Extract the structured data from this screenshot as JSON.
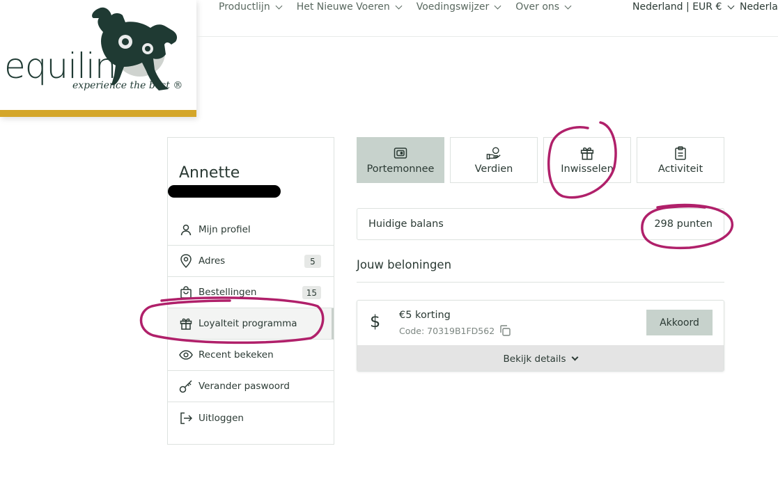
{
  "header": {
    "logo": {
      "text": "equilin",
      "tagline": "experience the best ®"
    },
    "nav": [
      {
        "label": "Productlijn"
      },
      {
        "label": "Het Nieuwe Voeren"
      },
      {
        "label": "Voedingswijzer"
      },
      {
        "label": "Over ons"
      }
    ],
    "region_label": "Nederland | EUR €",
    "language_label": "Nederlan"
  },
  "sidebar": {
    "user_name": "Annette",
    "items": [
      {
        "label": "Mijn profiel",
        "icon": "user-icon"
      },
      {
        "label": "Adres",
        "icon": "location-pin-icon",
        "badge": "5"
      },
      {
        "label": "Bestellingen",
        "icon": "shopping-bag-icon",
        "badge": "15"
      },
      {
        "label": "Loyalteit programma",
        "icon": "gift-icon",
        "active": true
      },
      {
        "label": "Recent bekeken",
        "icon": "eye-icon"
      },
      {
        "label": "Verander paswoord",
        "icon": "key-icon"
      },
      {
        "label": "Uitloggen",
        "icon": "logout-icon"
      }
    ]
  },
  "tabs": [
    {
      "label": "Portemonnee",
      "icon": "wallet-icon",
      "active": true
    },
    {
      "label": "Verdien",
      "icon": "earn-icon"
    },
    {
      "label": "Inwisselen",
      "icon": "gift-icon"
    },
    {
      "label": "Activiteit",
      "icon": "clipboard-icon"
    }
  ],
  "balance": {
    "label": "Huidige balans",
    "value": "298 punten"
  },
  "rewards": {
    "title": "Jouw beloningen",
    "items": [
      {
        "icon": "dollar-icon",
        "title": "€5 korting",
        "code": "Code: 70319B1FD562",
        "action_label": "Akkoord",
        "details_label": "Bekijk details"
      }
    ]
  },
  "colors": {
    "accent": "#c7d2cc",
    "brand_gold": "#d4a62a",
    "brand_green": "#1f3a33",
    "annotation": "#b0206a"
  }
}
